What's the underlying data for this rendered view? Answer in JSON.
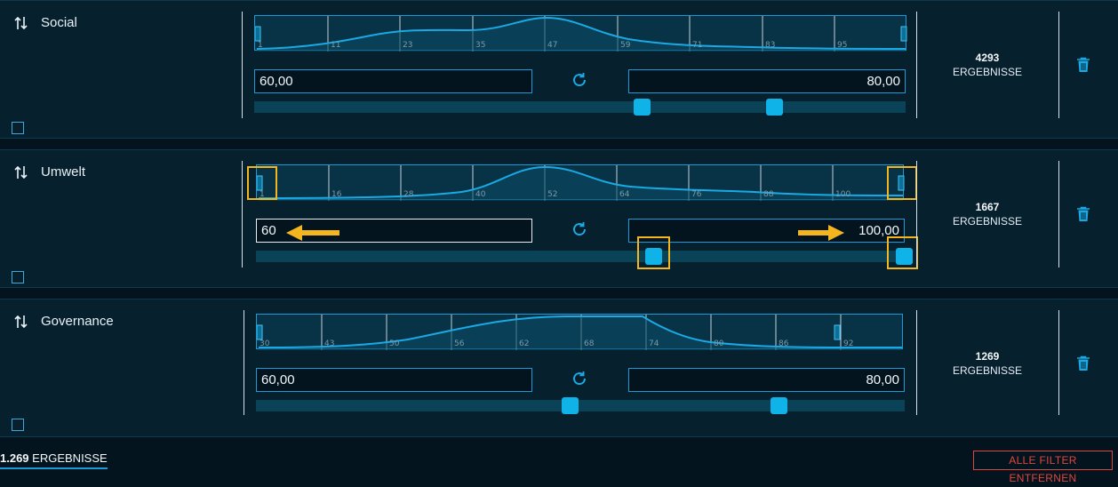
{
  "filters": [
    {
      "name": "Social",
      "min_value": "60,00",
      "max_value": "80,00",
      "ticks": [
        "1",
        "11",
        "23",
        "35",
        "47",
        "59",
        "71",
        "83",
        "95"
      ],
      "count": "4293",
      "count_label": "ERGEBNISSE",
      "slider_range_fraction": [
        0.595,
        0.795
      ],
      "hist_handle_fraction": [
        0.0,
        1.0
      ]
    },
    {
      "name": "Umwelt",
      "min_value": "60",
      "max_value": "100,00",
      "ticks": [
        "1",
        "16",
        "28",
        "40",
        "52",
        "64",
        "76",
        "88",
        "100"
      ],
      "count": "1667",
      "count_label": "ERGEBNISSE",
      "slider_range_fraction": [
        0.6,
        1.0
      ],
      "hist_handle_fraction": [
        0.0,
        1.0
      ]
    },
    {
      "name": "Governance",
      "min_value": "60,00",
      "max_value": "80,00",
      "ticks": [
        "30",
        "43",
        "50",
        "56",
        "62",
        "68",
        "74",
        "80",
        "86",
        "92"
      ],
      "count": "1269",
      "count_label": "ERGEBNISSE",
      "slider_range_fraction": [
        0.48,
        0.8
      ],
      "hist_handle_fraction": [
        0.0,
        0.9
      ]
    }
  ],
  "footer": {
    "total_count": "1.269",
    "total_label": "ERGEBNISSE",
    "clear_button": "ALLE FILTER ENTFERNEN"
  },
  "icons": [
    "sort-icon",
    "reset-icon",
    "trash-icon",
    "checkbox-icon",
    "arrow-left-icon",
    "arrow-right-icon"
  ],
  "colors": {
    "accent": "#1a9bd7",
    "thumb": "#0fb3e8",
    "highlight": "#f3b61f",
    "danger": "#e0463e"
  }
}
